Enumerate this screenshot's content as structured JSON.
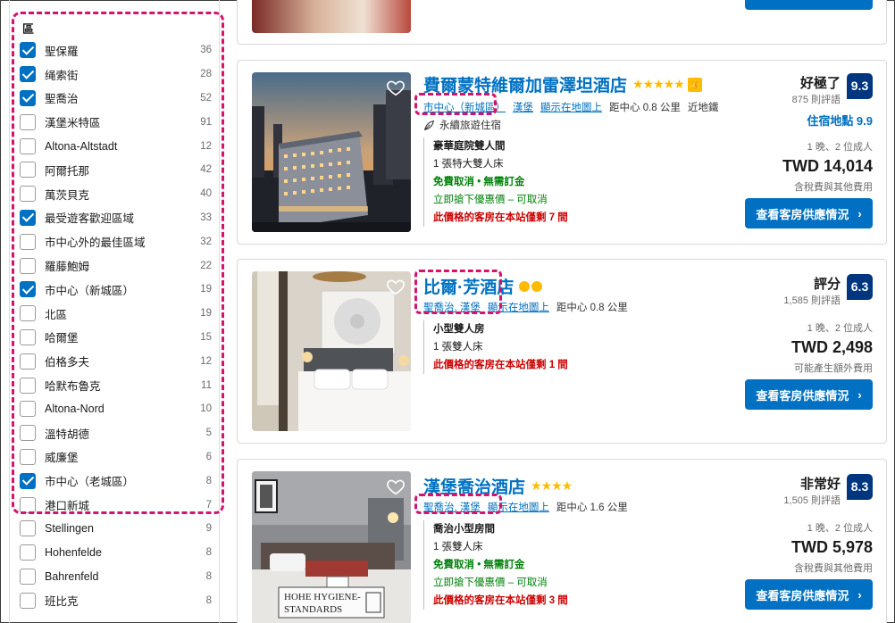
{
  "sidebar": {
    "title": "區",
    "items": [
      {
        "label": "聖保羅",
        "count": "36",
        "checked": true
      },
      {
        "label": "绳索街",
        "count": "28",
        "checked": true
      },
      {
        "label": "聖喬治",
        "count": "52",
        "checked": true
      },
      {
        "label": "漢堡米特區",
        "count": "91",
        "checked": false
      },
      {
        "label": "Altona-Altstadt",
        "count": "12",
        "checked": false
      },
      {
        "label": "阿爾托那",
        "count": "42",
        "checked": false
      },
      {
        "label": "萬茨貝克",
        "count": "40",
        "checked": false
      },
      {
        "label": "最受遊客歡迎區域",
        "count": "33",
        "checked": true
      },
      {
        "label": "市中心外的最佳區域",
        "count": "32",
        "checked": false
      },
      {
        "label": "羅藤鮑姆",
        "count": "22",
        "checked": false
      },
      {
        "label": "市中心（新城區）",
        "count": "19",
        "checked": true
      },
      {
        "label": "北區",
        "count": "19",
        "checked": false
      },
      {
        "label": "哈爾堡",
        "count": "15",
        "checked": false
      },
      {
        "label": "伯格多夫",
        "count": "12",
        "checked": false
      },
      {
        "label": "哈默布魯克",
        "count": "11",
        "checked": false
      },
      {
        "label": "Altona-Nord",
        "count": "10",
        "checked": false
      },
      {
        "label": "溫特胡德",
        "count": "5",
        "checked": false
      },
      {
        "label": "威廉堡",
        "count": "6",
        "checked": false
      },
      {
        "label": "市中心（老城區）",
        "count": "8",
        "checked": true
      },
      {
        "label": "港口新城",
        "count": "7",
        "checked": false
      },
      {
        "label": "Stellingen",
        "count": "9",
        "checked": false
      },
      {
        "label": "Hohenfelde",
        "count": "8",
        "checked": false
      },
      {
        "label": "Bahrenfeld",
        "count": "8",
        "checked": false
      },
      {
        "label": "班比克",
        "count": "8",
        "checked": false
      }
    ]
  },
  "hotels": [
    {
      "name": "費爾蒙特維爾加雷澤坦酒店",
      "stars": "★★★★★",
      "district": "市中心（新城區）",
      "city": "漢堡",
      "map_link": "顯示在地圖上",
      "distance": "距中心 0.8 公里",
      "extra": "近地鐵",
      "sustainable": "永續旅遊住宿",
      "room_name": "豪華庭院雙人間",
      "bed": "1 張特大雙人床",
      "free_cancel": "免費取消 • 無需訂金",
      "pay_later": "立即搶下優惠價 – 可取消",
      "scarcity": "此價格的客房在本站僅剩 7 間",
      "score_word": "好極了",
      "reviews": "875 則評語",
      "score": "9.3",
      "location_score": "住宿地點 9.9",
      "nights": "1 晚、2 位成人",
      "price": "TWD 14,014",
      "taxes": "含稅費與其他費用",
      "button": "查看客房供應情況"
    },
    {
      "name": "比爾·芳酒店",
      "district": "聖喬治, 漢堡",
      "map_link": "顯示在地圖上",
      "distance": "距中心 0.8 公里",
      "room_name": "小型雙人房",
      "bed": "1 張雙人床",
      "scarcity": "此價格的客房在本站僅剩 1 間",
      "score_word": "評分",
      "reviews": "1,585 則評語",
      "score": "6.3",
      "nights": "1 晚、2 位成人",
      "price": "TWD 2,498",
      "taxes": "可能產生額外費用",
      "button": "查看客房供應情況"
    },
    {
      "name": "漢堡喬治酒店",
      "stars": "★★★★",
      "district": "聖喬治, 漢堡",
      "map_link": "顯示在地圖上",
      "distance": "距中心 1.6 公里",
      "room_name": "喬治小型房間",
      "bed": "1 張雙人床",
      "free_cancel": "免費取消 • 無需訂金",
      "pay_later": "立即搶下優惠價 – 可取消",
      "scarcity": "此價格的客房在本站僅剩 3 間",
      "score_word": "非常好",
      "reviews": "1,505 則評語",
      "score": "8.3",
      "nights": "1 晚、2 位成人",
      "price": "TWD 5,978",
      "taxes": "含稅費與其他費用",
      "button": "查看客房供應情況",
      "image_caption_line1": "HOHE HYGIENE-",
      "image_caption_line2": "STANDARDS"
    }
  ],
  "colors": {
    "accent": "#0071c2",
    "score_bg": "#003580",
    "star": "#febb02",
    "highlight": "#d4136f",
    "green": "#008009",
    "red": "#cc0000"
  }
}
